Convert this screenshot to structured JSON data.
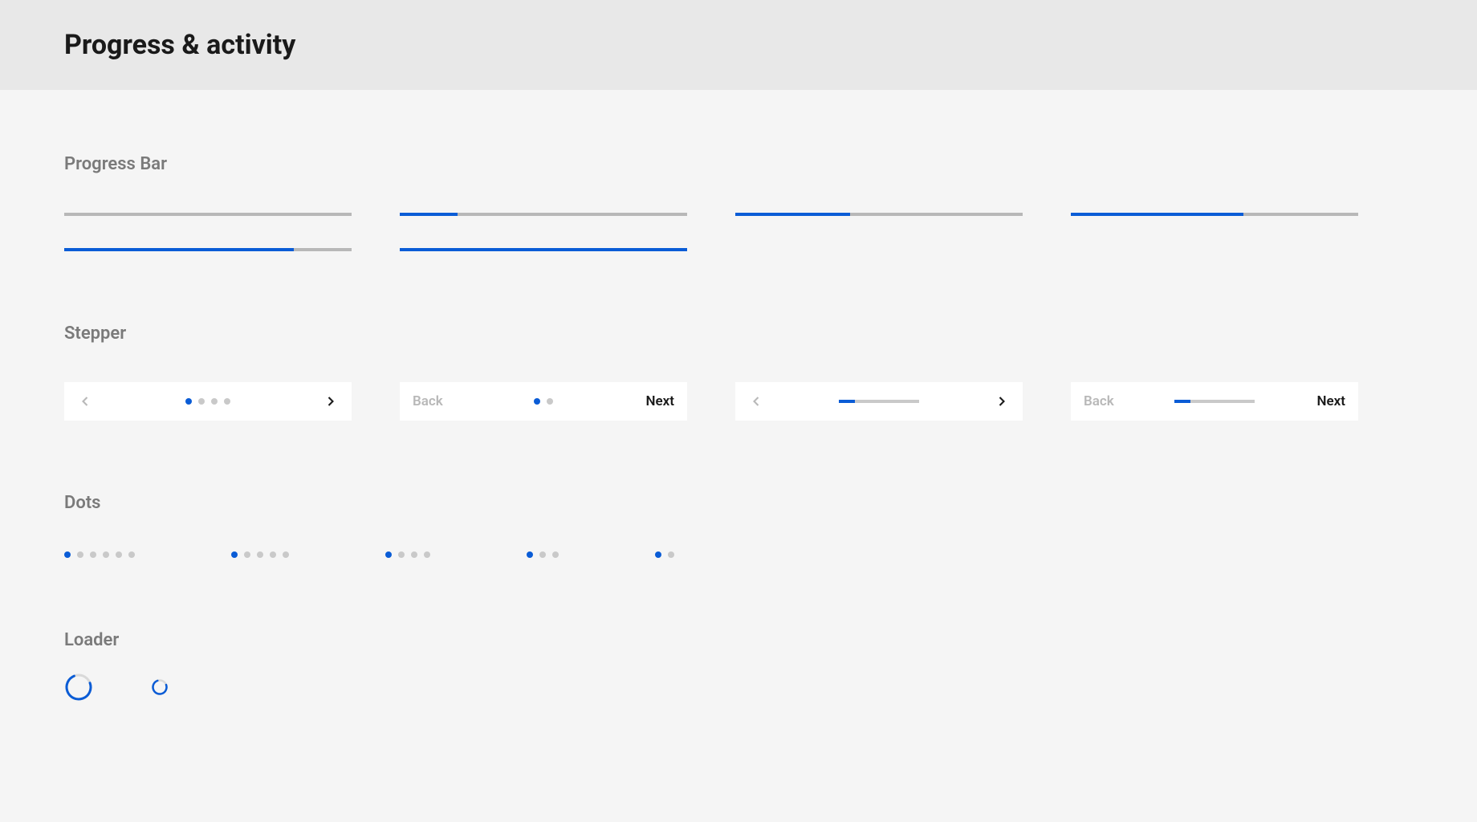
{
  "header": {
    "title": "Progress & activity"
  },
  "sections": {
    "progress_bar": {
      "title": "Progress Bar"
    },
    "stepper": {
      "title": "Stepper"
    },
    "dots": {
      "title": "Dots"
    },
    "loader": {
      "title": "Loader"
    }
  },
  "progress_bars": [
    {
      "percent": 0
    },
    {
      "percent": 20
    },
    {
      "percent": 40
    },
    {
      "percent": 60
    },
    {
      "percent": 80
    },
    {
      "percent": 100
    }
  ],
  "steppers": [
    {
      "type": "dots",
      "back": "chevron",
      "next": "chevron",
      "back_disabled": true,
      "total": 4,
      "current": 1
    },
    {
      "type": "dots",
      "back": "text",
      "next": "text",
      "back_label": "Back",
      "next_label": "Next",
      "back_disabled": true,
      "total": 2,
      "current": 1
    },
    {
      "type": "bar",
      "back": "chevron",
      "next": "chevron",
      "back_disabled": true,
      "percent": 20
    },
    {
      "type": "bar",
      "back": "text",
      "next": "text",
      "back_label": "Back",
      "next_label": "Next",
      "back_disabled": true,
      "percent": 20
    }
  ],
  "dots_groups": [
    {
      "total": 6,
      "current": 1
    },
    {
      "total": 5,
      "current": 1
    },
    {
      "total": 4,
      "current": 1
    },
    {
      "total": 3,
      "current": 1
    },
    {
      "total": 2,
      "current": 1
    }
  ],
  "loaders": [
    {
      "size": 36,
      "stroke": 3
    },
    {
      "size": 22,
      "stroke": 2.5
    }
  ],
  "colors": {
    "accent": "#0a5cd6",
    "track": "#b8b8b8",
    "dot_inactive": "#c9c9c9",
    "text_muted": "#7a7a7a"
  }
}
